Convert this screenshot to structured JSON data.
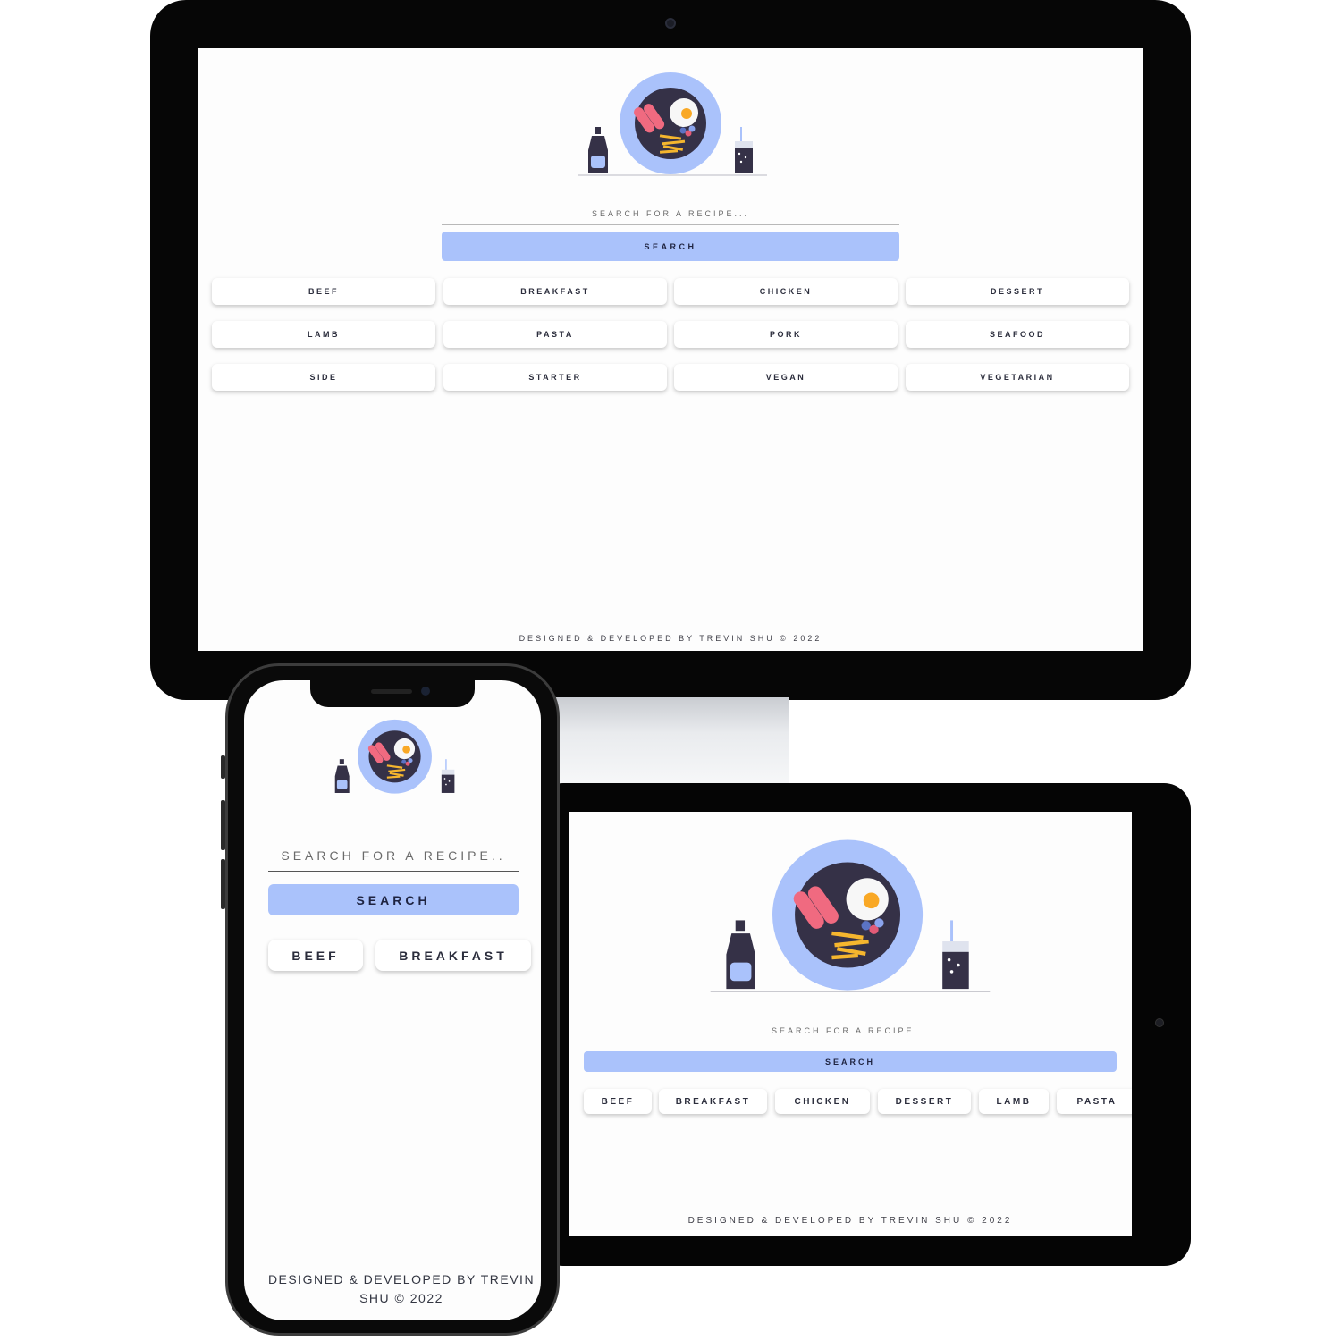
{
  "app": {
    "search": {
      "placeholder": "SEARCH FOR A RECIPE...",
      "button_label": "SEARCH"
    },
    "phone_search": {
      "placeholder": "SEARCH FOR A RECIPE.."
    },
    "categories": [
      "BEEF",
      "BREAKFAST",
      "CHICKEN",
      "DESSERT",
      "LAMB",
      "PASTA",
      "PORK",
      "SEAFOOD",
      "SIDE",
      "STARTER",
      "VEGAN",
      "VEGETARIAN"
    ],
    "footer": "DESIGNED & DEVELOPED BY TREVIN SHU © 2022"
  },
  "colors": {
    "accent": "#aac2fb",
    "plate_dark": "#353147",
    "sausage": "#f06a80",
    "egg_yolk": "#f9a825",
    "fries": "#f5b62e",
    "page_bg": "#fdfdfd"
  },
  "icons": [
    "hero-illustration",
    "ketchup-bottle-icon",
    "plate-icon",
    "egg-icon",
    "sausage-icon",
    "fries-icon",
    "soda-cup-icon"
  ]
}
